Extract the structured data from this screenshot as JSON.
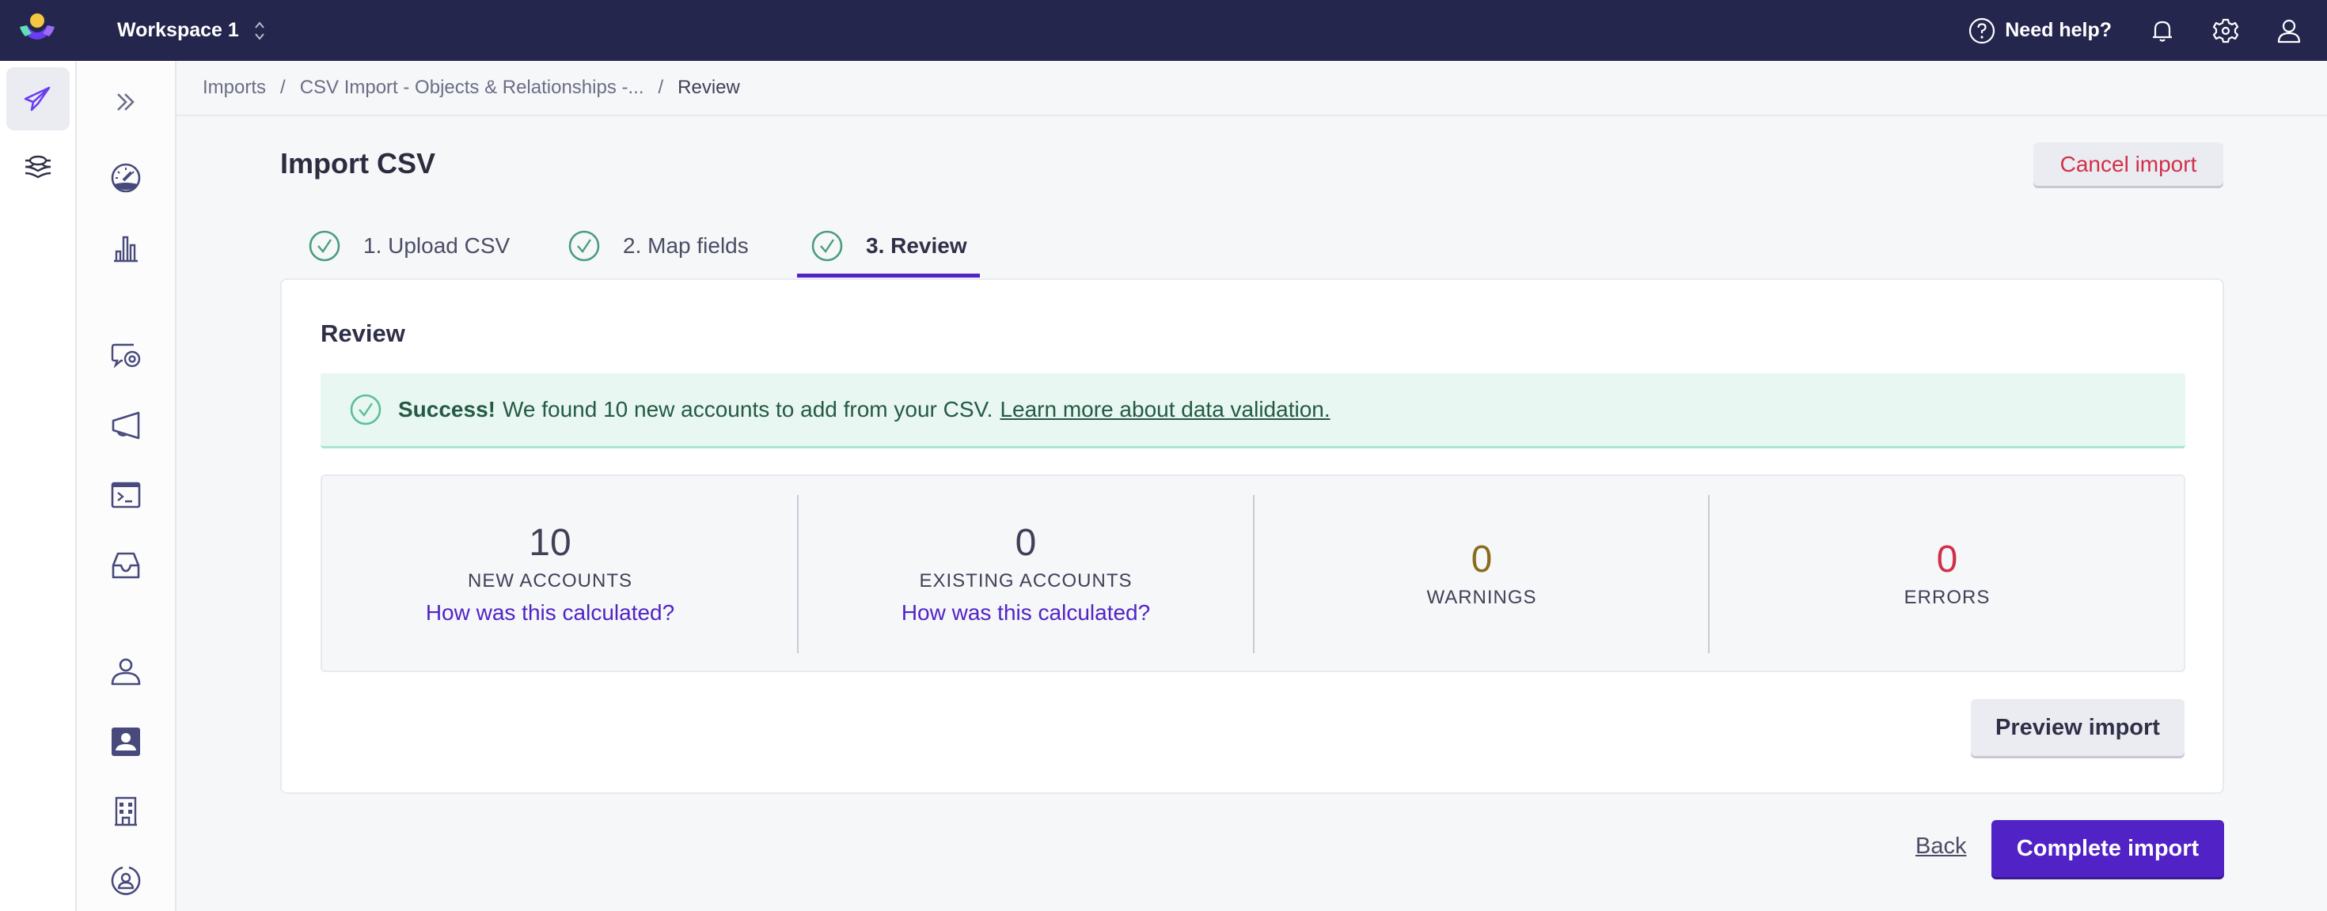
{
  "header": {
    "workspace": "Workspace 1",
    "help_label": "Need help?",
    "icons": [
      "help-circle-icon",
      "bell-icon",
      "gear-icon",
      "user-icon"
    ]
  },
  "rail_primary": {
    "items": [
      {
        "icon": "paper-plane-icon",
        "active": true
      },
      {
        "icon": "layers-icon",
        "active": false
      }
    ]
  },
  "rail_secondary": {
    "items": [
      {
        "icon": "double-chevron-right-icon"
      },
      {
        "icon": "gauge-icon"
      },
      {
        "icon": "bar-chart-icon"
      },
      {
        "icon": "chat-target-icon"
      },
      {
        "icon": "megaphone-icon"
      },
      {
        "icon": "terminal-icon"
      },
      {
        "icon": "inbox-icon"
      },
      {
        "icon": "person-icon"
      },
      {
        "icon": "contact-card-icon"
      },
      {
        "icon": "building-icon"
      },
      {
        "icon": "user-circle-icon"
      }
    ]
  },
  "breadcrumb": {
    "items": [
      "Imports",
      "CSV Import - Objects & Relationships -...",
      "Review"
    ],
    "separator": "/"
  },
  "page": {
    "title": "Import CSV",
    "cancel_label": "Cancel import"
  },
  "tabs": [
    {
      "label": "1. Upload CSV",
      "complete": true,
      "active": false
    },
    {
      "label": "2. Map fields",
      "complete": true,
      "active": false
    },
    {
      "label": "3. Review",
      "complete": true,
      "active": true
    }
  ],
  "review": {
    "heading": "Review",
    "banner": {
      "strong": "Success!",
      "text": "We found 10 new accounts to add from your CSV.",
      "link": "Learn more about data validation."
    },
    "stats": [
      {
        "value": "10",
        "label": "NEW ACCOUNTS",
        "link": "How was this calculated?",
        "color": "#3f4157"
      },
      {
        "value": "0",
        "label": "EXISTING ACCOUNTS",
        "link": "How was this calculated?",
        "color": "#3f4157"
      },
      {
        "value": "0",
        "label": "WARNINGS",
        "color": "#8a6d1c"
      },
      {
        "value": "0",
        "label": "ERRORS",
        "color": "#d1304a"
      }
    ],
    "preview_label": "Preview import"
  },
  "footer": {
    "back_label": "Back",
    "complete_label": "Complete import"
  },
  "colors": {
    "header_bg": "#24264d",
    "accent": "#5123c6",
    "success_bg": "#e8f7f1",
    "success_icon": "#4a9d7c",
    "danger": "#d1304a",
    "warning": "#8a6d1c"
  }
}
